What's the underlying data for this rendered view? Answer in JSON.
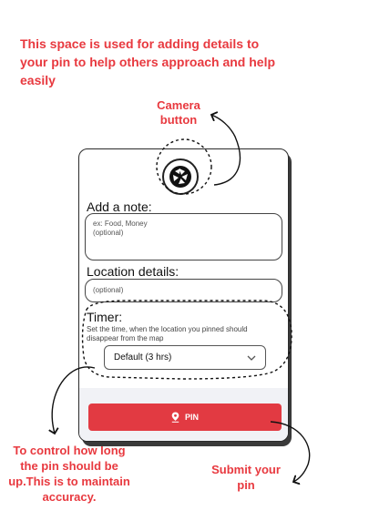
{
  "annotations": {
    "intro": "This space is used for adding details to your pin to help others approach and help easily",
    "camera_label": "Camera button",
    "timer_note": "To control how long the pin should be up.This is to maintain accuracy.",
    "submit_note": "Submit your pin"
  },
  "form": {
    "note_title": "Add a note:",
    "note_placeholder_line1": "ex: Food, Money",
    "note_placeholder_line2": "(optional)",
    "location_title": "Location details:",
    "location_placeholder": "(optional)",
    "timer_title": "Timer:",
    "timer_description": "Set the time, when the location you pinned should disappear from the map",
    "timer_selected": "Default (3 hrs)",
    "pin_label": "PIN"
  },
  "icons": {
    "camera": "camera-aperture-icon",
    "select_caret": "chevron-down-icon",
    "pin": "location-pin-icon"
  },
  "colors": {
    "accent": "#e8393f",
    "pin_button": "#e23a42"
  }
}
